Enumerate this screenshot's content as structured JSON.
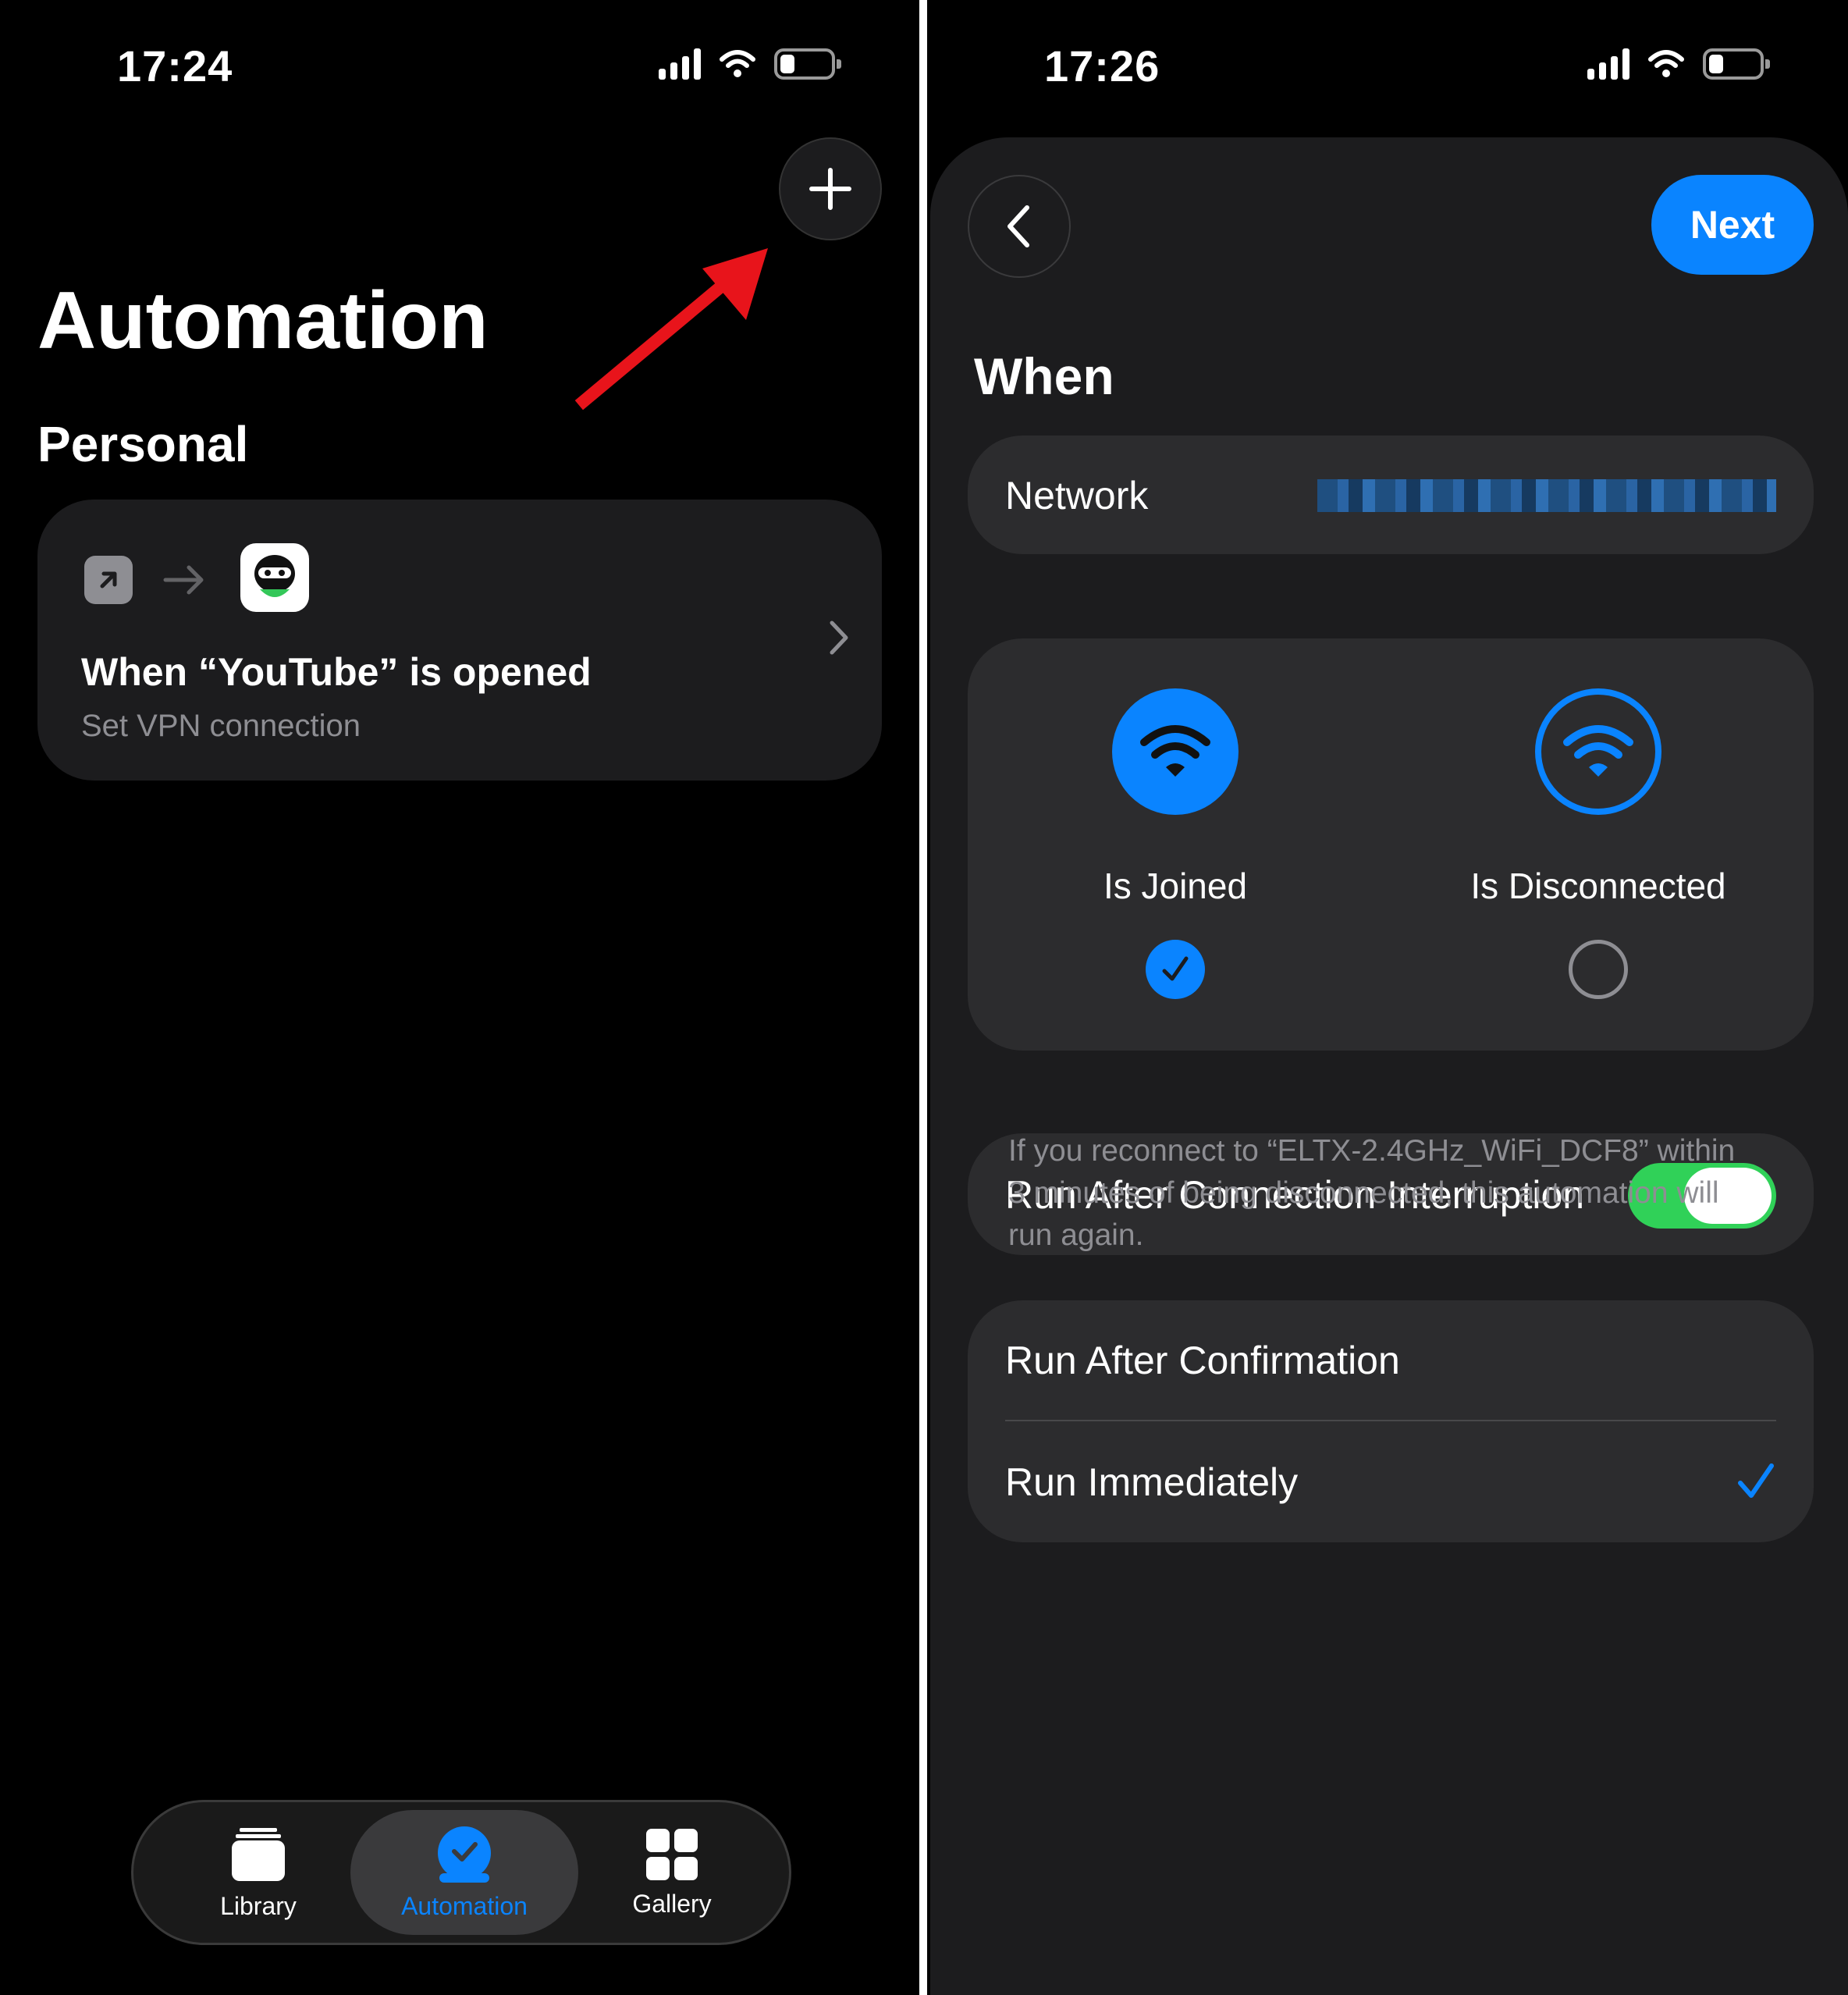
{
  "left": {
    "status_time": "17:24",
    "page_title": "Automation",
    "section_title": "Personal",
    "automation_card": {
      "title": "When “YouTube” is opened",
      "subtitle": "Set VPN connection"
    },
    "tabs": [
      {
        "label": "Library",
        "icon": "library-icon"
      },
      {
        "label": "Automation",
        "icon": "automation-icon",
        "selected": true
      },
      {
        "label": "Gallery",
        "icon": "gallery-icon"
      }
    ]
  },
  "right": {
    "status_time": "17:26",
    "next_label": "Next",
    "when_title": "When",
    "network_label": "Network",
    "states": {
      "joined_label": "Is Joined",
      "disconnected_label": "Is Disconnected",
      "selected": "joined"
    },
    "interruption_label": "Run After Connection Interruption",
    "interruption_enabled": true,
    "footnote": "If you reconnect to “ELTX-2.4GHz_WiFi_DCF8” within 3 minutes of being disconnected, this automation will run again.",
    "run_after_confirmation_label": "Run After Confirmation",
    "run_immediately_label": "Run Immediately",
    "run_selected": "immediately"
  },
  "colors": {
    "accent": "#0a84ff",
    "toggle_on": "#30d158",
    "annotation_arrow": "#e8141b"
  }
}
